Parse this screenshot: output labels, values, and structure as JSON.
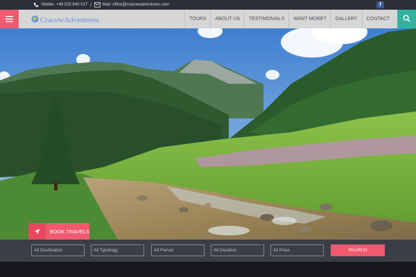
{
  "topbar": {
    "mobile_label": "Mobile: +48 515 640 017",
    "separator": "|",
    "mail_label": "Mail: office@cracowadventures.com",
    "facebook_glyph": "f"
  },
  "header": {
    "logo_text": "CracowAdventures",
    "nav_items": [
      "TOURS",
      "ABOUT US",
      "TESTIMONIALS",
      "WANT MORE?",
      "GALLERY",
      "CONTACT"
    ]
  },
  "hero": {
    "book_label": "BOOK TRAVELS"
  },
  "filters": {
    "destination": "All Destination",
    "typology": "All Typology",
    "period": "All Period",
    "duration": "All Duration",
    "price": "All Price",
    "search_label": "SEARCH"
  },
  "colors": {
    "accent_pink": "#f05a6e",
    "accent_teal": "#33b39d",
    "facebook_blue": "#3b5998",
    "topbar_bg": "#2b2f36",
    "filterbar_bg": "#3a3f47"
  },
  "icons": [
    "phone-icon",
    "mail-icon",
    "facebook-icon",
    "hamburger-menu-icon",
    "search-icon",
    "logo-globe-icon",
    "location-arrow-icon"
  ]
}
